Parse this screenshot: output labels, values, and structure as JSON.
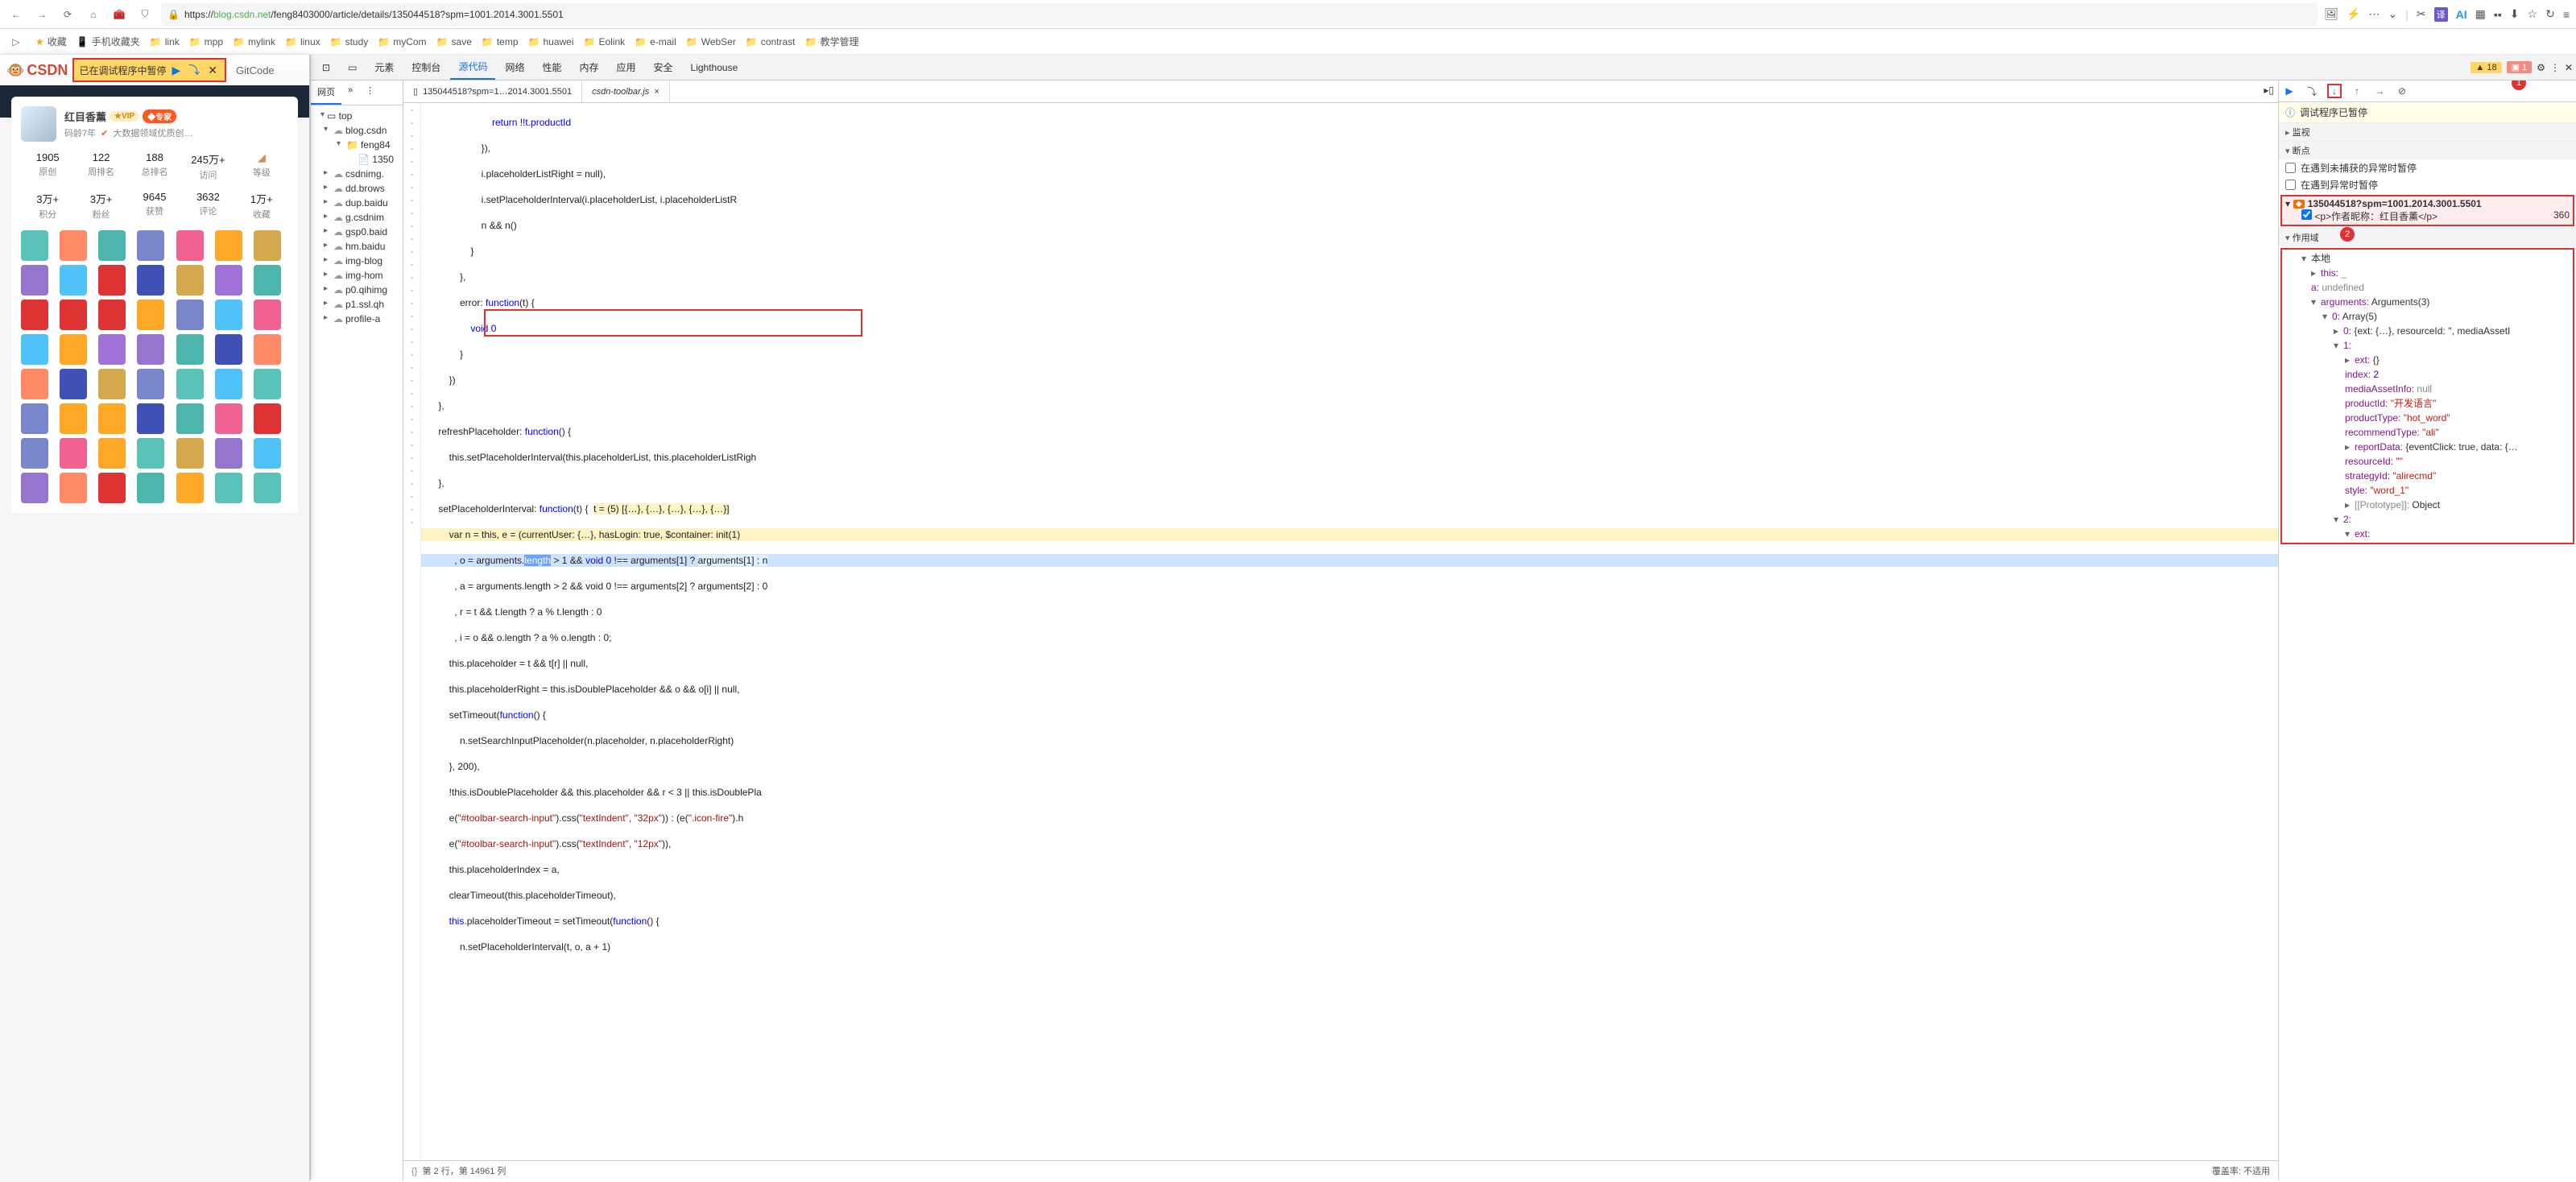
{
  "browser": {
    "url_prefix": "https://",
    "url_domain": "blog.csdn.net",
    "url_path": "/feng8403000/article/details/135044518?spm=1001.2014.3001.5501"
  },
  "bookmarks": {
    "fav": "收藏",
    "mobile": "手机收藏夹",
    "items": [
      "link",
      "mpp",
      "mylink",
      "linux",
      "study",
      "myCom",
      "save",
      "temp",
      "huawei",
      "Eolink",
      "e-mail",
      "WebSer",
      "contrast",
      "教学管理"
    ]
  },
  "csdn": {
    "logo": "CSDN",
    "debug_text": "已在调试程序中暂停",
    "gitcode": "GitCode",
    "name": "红目香薰",
    "vip": "VIP",
    "expert": "专家",
    "age": "码龄7年",
    "field": "大数据领域优质创…",
    "stats_r1": [
      {
        "n": "1905",
        "l": "原创"
      },
      {
        "n": "122",
        "l": "周排名"
      },
      {
        "n": "188",
        "l": "总排名"
      },
      {
        "n": "245万+",
        "l": "访问"
      },
      {
        "n": "",
        "l": "等级"
      }
    ],
    "stats_r2": [
      {
        "n": "3万+",
        "l": "积分"
      },
      {
        "n": "3万+",
        "l": "粉丝"
      },
      {
        "n": "9645",
        "l": "获赞"
      },
      {
        "n": "3632",
        "l": "评论"
      },
      {
        "n": "1万+",
        "l": "收藏"
      }
    ]
  },
  "devtools": {
    "tabs": [
      "元素",
      "控制台",
      "源代码",
      "网络",
      "性能",
      "内存",
      "应用",
      "安全",
      "Lighthouse"
    ],
    "active_tab": "源代码",
    "warnings": "18",
    "errors": "1"
  },
  "sources": {
    "tree_tab": "网页",
    "nodes": {
      "top": "top",
      "blog": "blog.csdn",
      "feng": "feng84",
      "article": "1350",
      "hosts": [
        "csdnimg.",
        "dd.brows",
        "dup.baidu",
        "g.csdnim",
        "gsp0.baid",
        "hm.baidu",
        "img-blog",
        "img-hom",
        "p0.qihimg",
        "p1.ssl.qh",
        "profile-a"
      ]
    }
  },
  "code_tabs": {
    "tab1": "135044518?spm=1…2014.3001.5501",
    "tab2": "csdn-toolbar.js"
  },
  "code": {
    "l1": "                        return !!t.productId",
    "l2": "                    }),",
    "l3": "                    i.placeholderListRight = null),",
    "l4": "                    i.setPlaceholderInterval(i.placeholderList, i.placeholderListR",
    "l5": "                    n && n()",
    "l6": "                }",
    "l7": "            },",
    "l8": "            error: function(t) {",
    "l9": "                void 0",
    "l10": "            }",
    "l11": "        })",
    "l12": "    },",
    "l13": "    refreshPlaceholder: function() {",
    "l14": "        this.setPlaceholderInterval(this.placeholderList, this.placeholderListRigh",
    "l15": "    },",
    "l16_a": "    setPlaceholderInterval: ",
    "l16_b": "function",
    "l16_c": "(t) {  ",
    "l16_inline": "t = (5) [{…}, {…}, {…}, {…}, {…}]",
    "l17": "        var n = this, e = (currentUser: {…}, hasLogin: true, $container: init(1)",
    "l18_a": "          , o = arguments.",
    "l18_b": "length",
    "l18_c": " > 1 && ",
    "l18_d": "void 0",
    "l18_e": " !== arguments[1] ? ",
    "l18_f": "arguments[1] : n",
    "l19": "          , a = arguments.length > 2 && void 0 !== arguments[2] ? arguments[2] : 0",
    "l20": "          , r = t && t.length ? a % t.length : 0",
    "l21": "          , i = o && o.length ? a % o.length : 0;",
    "l22": "        this.placeholder = t && t[r] || null,",
    "l23": "        this.placeholderRight = this.isDoublePlaceholder && o && o[i] || null,",
    "l24": "        setTimeout(function() {",
    "l25": "            n.setSearchInputPlaceholder(n.placeholder, n.placeholderRight)",
    "l26": "        }, 200),",
    "l27": "        !this.isDoublePlaceholder && this.placeholder && r < 3 || this.isDoublePla",
    "l28": "        e(\"#toolbar-search-input\").css(\"textIndent\", \"32px\")) : (e(\".icon-fire\").h",
    "l29": "        e(\"#toolbar-search-input\").css(\"textIndent\", \"12px\")),",
    "l30": "        this.placeholderIndex = a,",
    "l31": "        clearTimeout(this.placeholderTimeout),",
    "l32": "        this.placeholderTimeout = setTimeout(function() {",
    "l33": "            n.setPlaceholderInterval(t, o, a + 1)"
  },
  "code_foot": {
    "pos": "第 2 行，第 14961 列",
    "cov": "覆盖率: 不适用"
  },
  "debug": {
    "status": "调试程序已暂停",
    "watch": "监视",
    "breakpoints": "断点",
    "bp1": "在遇到未捕获的异常时暂停",
    "bp2": "在遇到异常时暂停",
    "bp_file": "135044518?spm=1001.2014.3001.5501",
    "bp_line": "<p>作者昵称：红目香薰</p>",
    "bp_col": "360",
    "scope": "作用域",
    "local": "本地",
    "this": "this:",
    "this_val": "_",
    "a_key": "a:",
    "a_val": "undefined",
    "args": "arguments:",
    "args_val": "Arguments(3)",
    "arr0": "0:",
    "arr0_val": "Array(5)",
    "arr00": "0:",
    "arr00_val": "{ext: {…}, resourceId: '', mediaAssetI",
    "arr01": "1:",
    "ext_k": "ext:",
    "ext_v": "{}",
    "index_k": "index:",
    "index_v": "2",
    "media_k": "mediaAssetInfo:",
    "media_v": "null",
    "pid_k": "productId:",
    "pid_v": "\"开发语言\"",
    "ptype_k": "productType:",
    "ptype_v": "\"hot_word\"",
    "rtype_k": "recommendType:",
    "rtype_v": "\"ali\"",
    "rdata_k": "reportData:",
    "rdata_v": "{eventClick: true, data: {…",
    "rid_k": "resourceId:",
    "rid_v": "\"\"",
    "sid_k": "strategyId:",
    "sid_v": "\"alirecmd\"",
    "style_k": "style:",
    "style_v": "\"word_1\"",
    "proto_k": "[[Prototype]]:",
    "proto_v": "Object",
    "arr02": "2:",
    "ext2_k": "ext:"
  }
}
